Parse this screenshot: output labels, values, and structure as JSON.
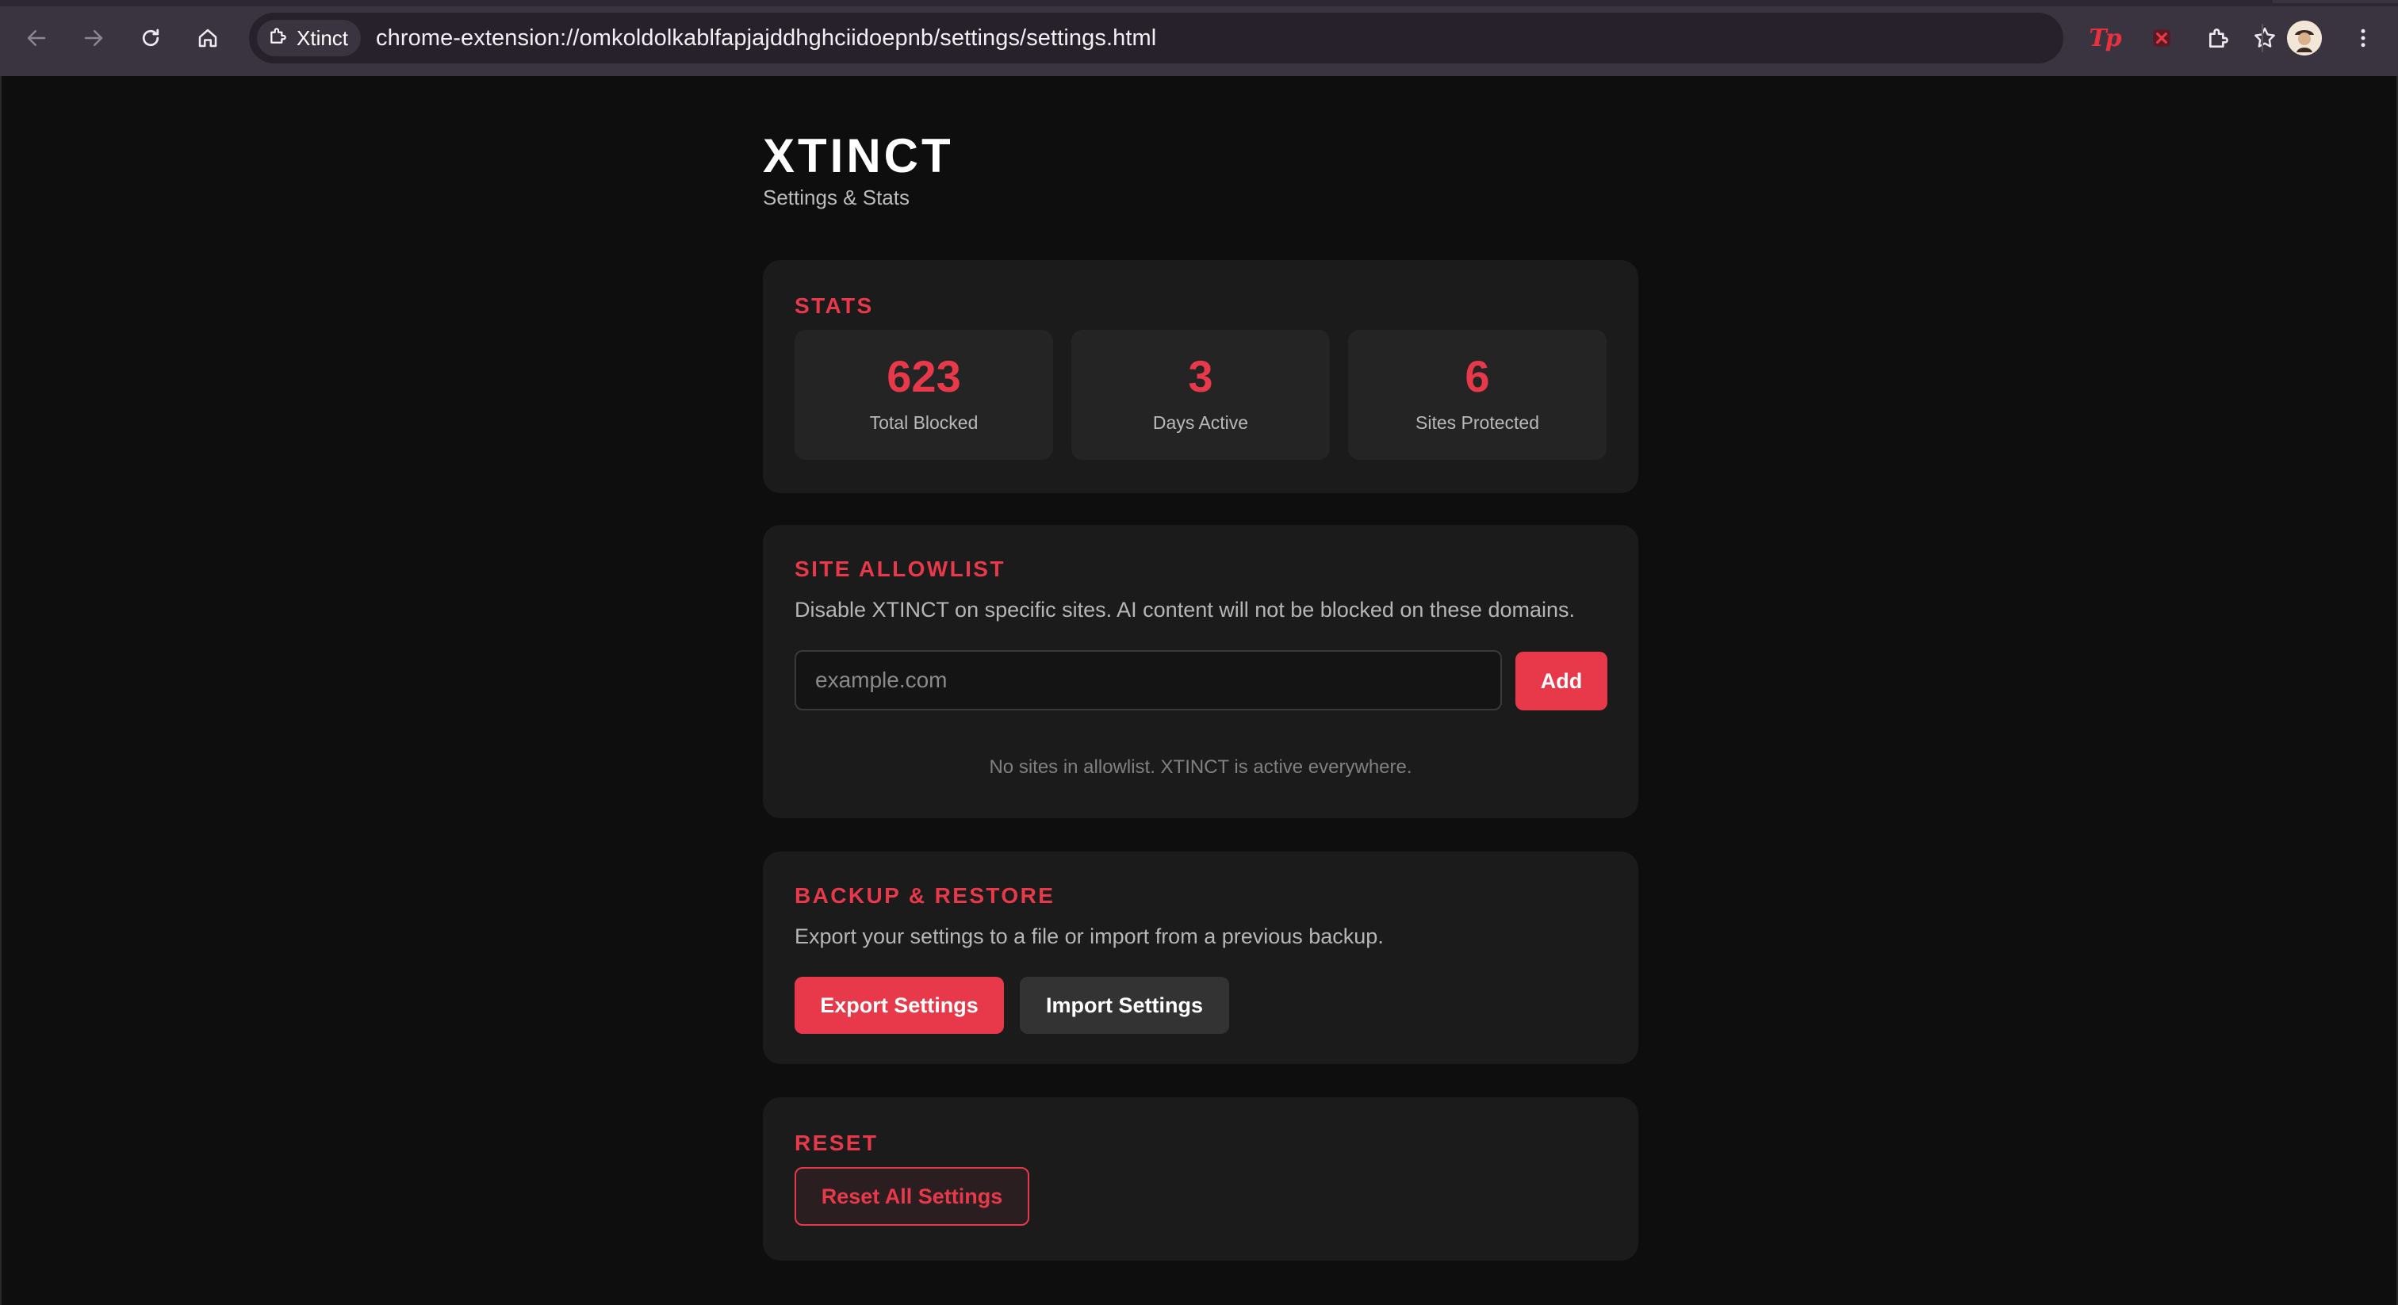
{
  "browser": {
    "tab_chip_label": "Xtinct",
    "url": "chrome-extension://omkoldolkablfapjajddhghciidoepnb/settings/settings.html",
    "extension_label_tp": "Tp",
    "icons": [
      "back-icon",
      "forward-icon",
      "reload-icon",
      "home-icon",
      "extension-puzzle-icon",
      "bookmark-star-icon",
      "puzzle-extensions-icon",
      "profile-avatar",
      "kebab-menu-icon"
    ],
    "accent": "#e8394a"
  },
  "header": {
    "brand": "XTINCT",
    "subtitle": "Settings & Stats"
  },
  "stats": {
    "title": "STATS",
    "items": [
      {
        "value": "623",
        "label": "Total Blocked"
      },
      {
        "value": "3",
        "label": "Days Active"
      },
      {
        "value": "6",
        "label": "Sites Protected"
      }
    ]
  },
  "allowlist": {
    "title": "SITE ALLOWLIST",
    "description": "Disable XTINCT on specific sites. AI content will not be blocked on these domains.",
    "input_placeholder": "example.com",
    "input_value": "",
    "add_label": "Add",
    "empty_message": "No sites in allowlist. XTINCT is active everywhere."
  },
  "backup": {
    "title": "BACKUP & RESTORE",
    "description": "Export your settings to a file or import from a previous backup.",
    "export_label": "Export Settings",
    "import_label": "Import Settings"
  },
  "reset": {
    "title": "RESET",
    "reset_label": "Reset All Settings"
  }
}
